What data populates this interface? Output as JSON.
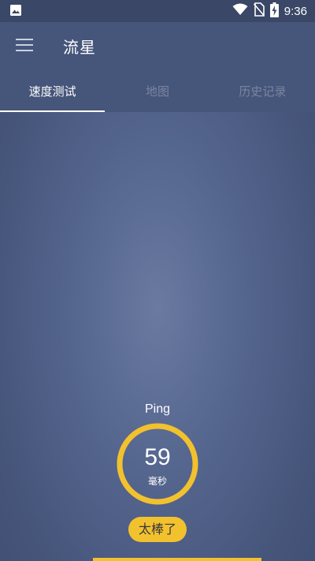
{
  "status_bar": {
    "time": "9:36",
    "icons": [
      "image-notification-icon",
      "wifi-icon",
      "no-sim-icon",
      "battery-charging-icon"
    ]
  },
  "app_bar": {
    "title": "流星",
    "menu_icon": "hamburger-menu-icon"
  },
  "tabs": [
    {
      "label": "速度测试",
      "active": true
    },
    {
      "label": "地图",
      "active": false
    },
    {
      "label": "历史记录",
      "active": false
    }
  ],
  "ping": {
    "label": "Ping",
    "value": "59",
    "unit": "毫秒",
    "rating": "太棒了"
  },
  "colors": {
    "accent": "#f2c12e",
    "app_bar": "#46557a",
    "status_bar": "#3a4766"
  }
}
